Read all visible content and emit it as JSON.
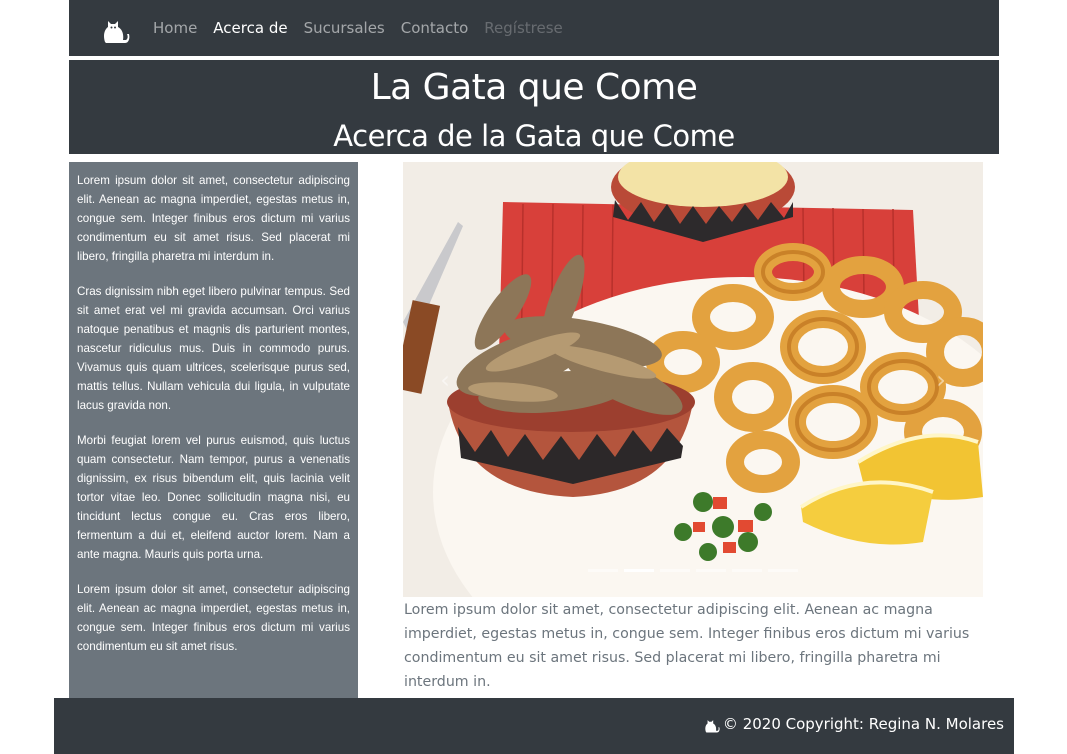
{
  "nav": {
    "brand_icon": "cat-icon",
    "links": [
      {
        "label": "Home",
        "state": "normal"
      },
      {
        "label": "Acerca de",
        "state": "active"
      },
      {
        "label": "Sucursales",
        "state": "normal"
      },
      {
        "label": "Contacto",
        "state": "normal"
      },
      {
        "label": "Regístrese",
        "state": "disabled"
      }
    ]
  },
  "header": {
    "title": "La Gata que Come",
    "subtitle": "Acerca de la Gata que Come"
  },
  "sidebar": {
    "paragraphs": [
      "Lorem ipsum dolor sit amet, consectetur adipiscing elit. Aenean ac magna imperdiet, egestas metus in, congue sem. Integer finibus eros dictum mi varius condimentum eu sit amet risus. Sed placerat mi libero, fringilla pharetra mi interdum in.",
      "Cras dignissim nibh eget libero pulvinar tempus. Sed sit amet erat vel mi gravida accumsan. Orci varius natoque penatibus et magnis dis parturient montes, nascetur ridiculus mus. Duis in commodo purus. Vivamus quis quam ultrices, scelerisque purus sed, mattis tellus. Nullam vehicula dui ligula, in vulputate lacus gravida non.",
      "Morbi feugiat lorem vel purus euismod, quis luctus quam consectetur. Nam tempor, purus a venenatis dignissim, ex risus bibendum elit, quis lacinia velit tortor vitae leo. Donec sollicitudin magna nisi, eu tincidunt lectus congue eu. Cras eros libero, fermentum a dui et, eleifend auctor lorem. Nam a ante magna. Mauris quis porta urna.",
      "Lorem ipsum dolor sit amet, consectetur adipiscing elit. Aenean ac magna imperdiet, egestas metus in, congue sem. Integer finibus eros dictum mi varius condimentum eu sit amet risus."
    ]
  },
  "carousel": {
    "prev_icon": "chevron-left-icon",
    "next_icon": "chevron-right-icon",
    "prev_glyph": "‹",
    "next_glyph": "›",
    "slide_count": 6,
    "active_index": 1
  },
  "caption": "Lorem ipsum dolor sit amet, consectetur adipiscing elit. Aenean ac magna imperdiet, egestas metus in, congue sem. Integer finibus eros dictum mi varius condimentum eu sit amet risus. Sed placerat mi libero, fringilla pharetra mi interdum in.",
  "footer": {
    "icon": "cat-icon",
    "copyright": "© 2020 Copyright: Regina N. Molares"
  },
  "colors": {
    "dark": "#343a40",
    "secondary": "#6c757d"
  }
}
